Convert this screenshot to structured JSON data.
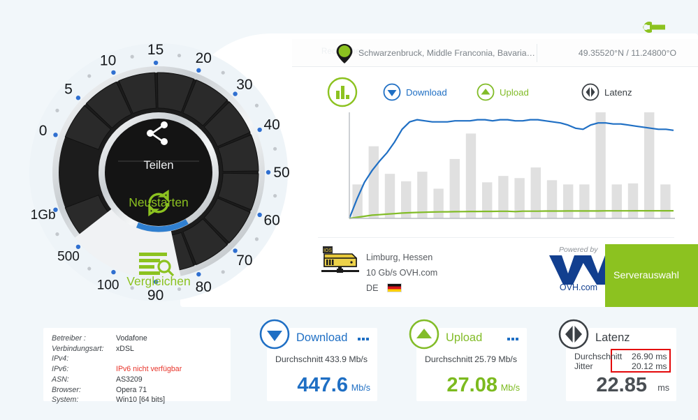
{
  "header": {
    "settings_icon": "wrench-icon"
  },
  "location": {
    "ghost_text": "Rechtliches",
    "pin_icon": "map-pin-icon",
    "place": "Schwarzenbruck, Middle Franconia, Bavaria…",
    "coordinates": "49.35520°N / 11.24800°O"
  },
  "legend": {
    "badge_icon": "bar-chart-icon",
    "download": {
      "label": "Download",
      "icon": "download-arrow-icon",
      "color": "#1f6fc4"
    },
    "upload": {
      "label": "Upload",
      "icon": "upload-arrow-icon",
      "color": "#82bc28"
    },
    "latency": {
      "label": "Latenz",
      "icon": "latency-icon",
      "color": "#3b4045"
    }
  },
  "gauge": {
    "scale": [
      "0",
      "5",
      "10",
      "15",
      "20",
      "30",
      "40",
      "50",
      "60",
      "70",
      "80",
      "90",
      "100",
      "500",
      "1Gb"
    ],
    "share_label": "Teilen",
    "share_icon": "share-icon",
    "restart_label": "Neustarten",
    "restart_icon": "refresh-icon",
    "compare_label": "Vergleichen",
    "compare_icon": "compare-search-icon"
  },
  "server": {
    "icon": "server-icon",
    "city": "Limburg, Hessen",
    "capacity": "10 Gb/s OVH.com",
    "country_code": "DE",
    "flag": "de-flag-icon",
    "powered_by": "Powered by",
    "provider_logo": "ovh-logo",
    "provider_name": "OVH.com",
    "select_button": "Serverauswahl"
  },
  "connection_info": {
    "rows": [
      {
        "key": "Betreiber :",
        "value": "Vodafone",
        "highlight": false
      },
      {
        "key": "Verbindungsart:",
        "value": "xDSL",
        "highlight": false
      },
      {
        "key": "IPv4:",
        "value": "",
        "highlight": false
      },
      {
        "key": "IPv6:",
        "value": "IPv6 nicht verfügbar",
        "highlight": true
      },
      {
        "key": "ASN:",
        "value": "AS3209",
        "highlight": false
      },
      {
        "key": "Browser:",
        "value": "Opera 71",
        "highlight": false
      },
      {
        "key": "System:",
        "value": "Win10 [64 bits]",
        "highlight": false
      }
    ]
  },
  "cards": {
    "download": {
      "title": "Download",
      "icon": "download-arrow-icon",
      "menu_icon": "more-options-icon",
      "avg_label": "Durchschnitt",
      "avg_value": "433.9 Mb/s",
      "value": "447.6",
      "unit": "Mb/s",
      "color": "#1f6fc4"
    },
    "upload": {
      "title": "Upload",
      "icon": "upload-arrow-icon",
      "menu_icon": "more-options-icon",
      "avg_label": "Durchschnitt",
      "avg_value": "25.79 Mb/s",
      "value": "27.08",
      "unit": "Mb/s",
      "color": "#7cba1f"
    },
    "latency": {
      "title": "Latenz",
      "icon": "latency-icon",
      "avg_label": "Durchschnitt",
      "avg_value": "26.90 ms",
      "jitter_label": "Jitter",
      "jitter_value": "20.12 ms",
      "value": "22.85",
      "unit": "ms",
      "color": "#4a4f54",
      "highlight_color": "#e4080a"
    }
  },
  "chart_data": {
    "type": "line",
    "title": "",
    "xlabel": "",
    "ylabel": "",
    "grid": false,
    "legend_position": "top",
    "series": [
      {
        "name": "Latenz",
        "type": "bar",
        "color": "#e0e0e0",
        "values": [
          32,
          68,
          42,
          35,
          44,
          28,
          56,
          80,
          34,
          40,
          38,
          48,
          36,
          32,
          32,
          100,
          32,
          33,
          100,
          32
        ]
      },
      {
        "name": "Download",
        "type": "line",
        "color": "#1f6fc4",
        "values": [
          0,
          18,
          34,
          45,
          54,
          62,
          72,
          84,
          91,
          93,
          92,
          91,
          91,
          91,
          92,
          92,
          92,
          93,
          93,
          92,
          93,
          93,
          92,
          92,
          93,
          93,
          92,
          91,
          90,
          88,
          85,
          84,
          88,
          90,
          90,
          89,
          89,
          88,
          87,
          86,
          85,
          84,
          84,
          83
        ]
      },
      {
        "name": "Upload",
        "type": "line",
        "color": "#82bc28",
        "values": [
          0,
          1,
          2,
          3,
          3.5,
          4,
          4.5,
          5,
          5.3,
          5.6,
          5.8,
          6,
          6.1,
          6.2,
          6.3,
          6.4,
          6.5,
          6.5,
          6.6,
          6.6,
          6.7,
          6.7,
          6.4,
          6.8,
          6.8,
          6.8,
          6.9,
          6.9,
          6.9,
          7,
          7,
          7,
          7,
          7,
          7.1,
          7.1,
          7.1,
          7.1,
          7.2,
          7.2,
          7.2,
          7.2,
          7.2,
          7.2
        ]
      }
    ],
    "ylim": [
      0,
      100
    ]
  }
}
